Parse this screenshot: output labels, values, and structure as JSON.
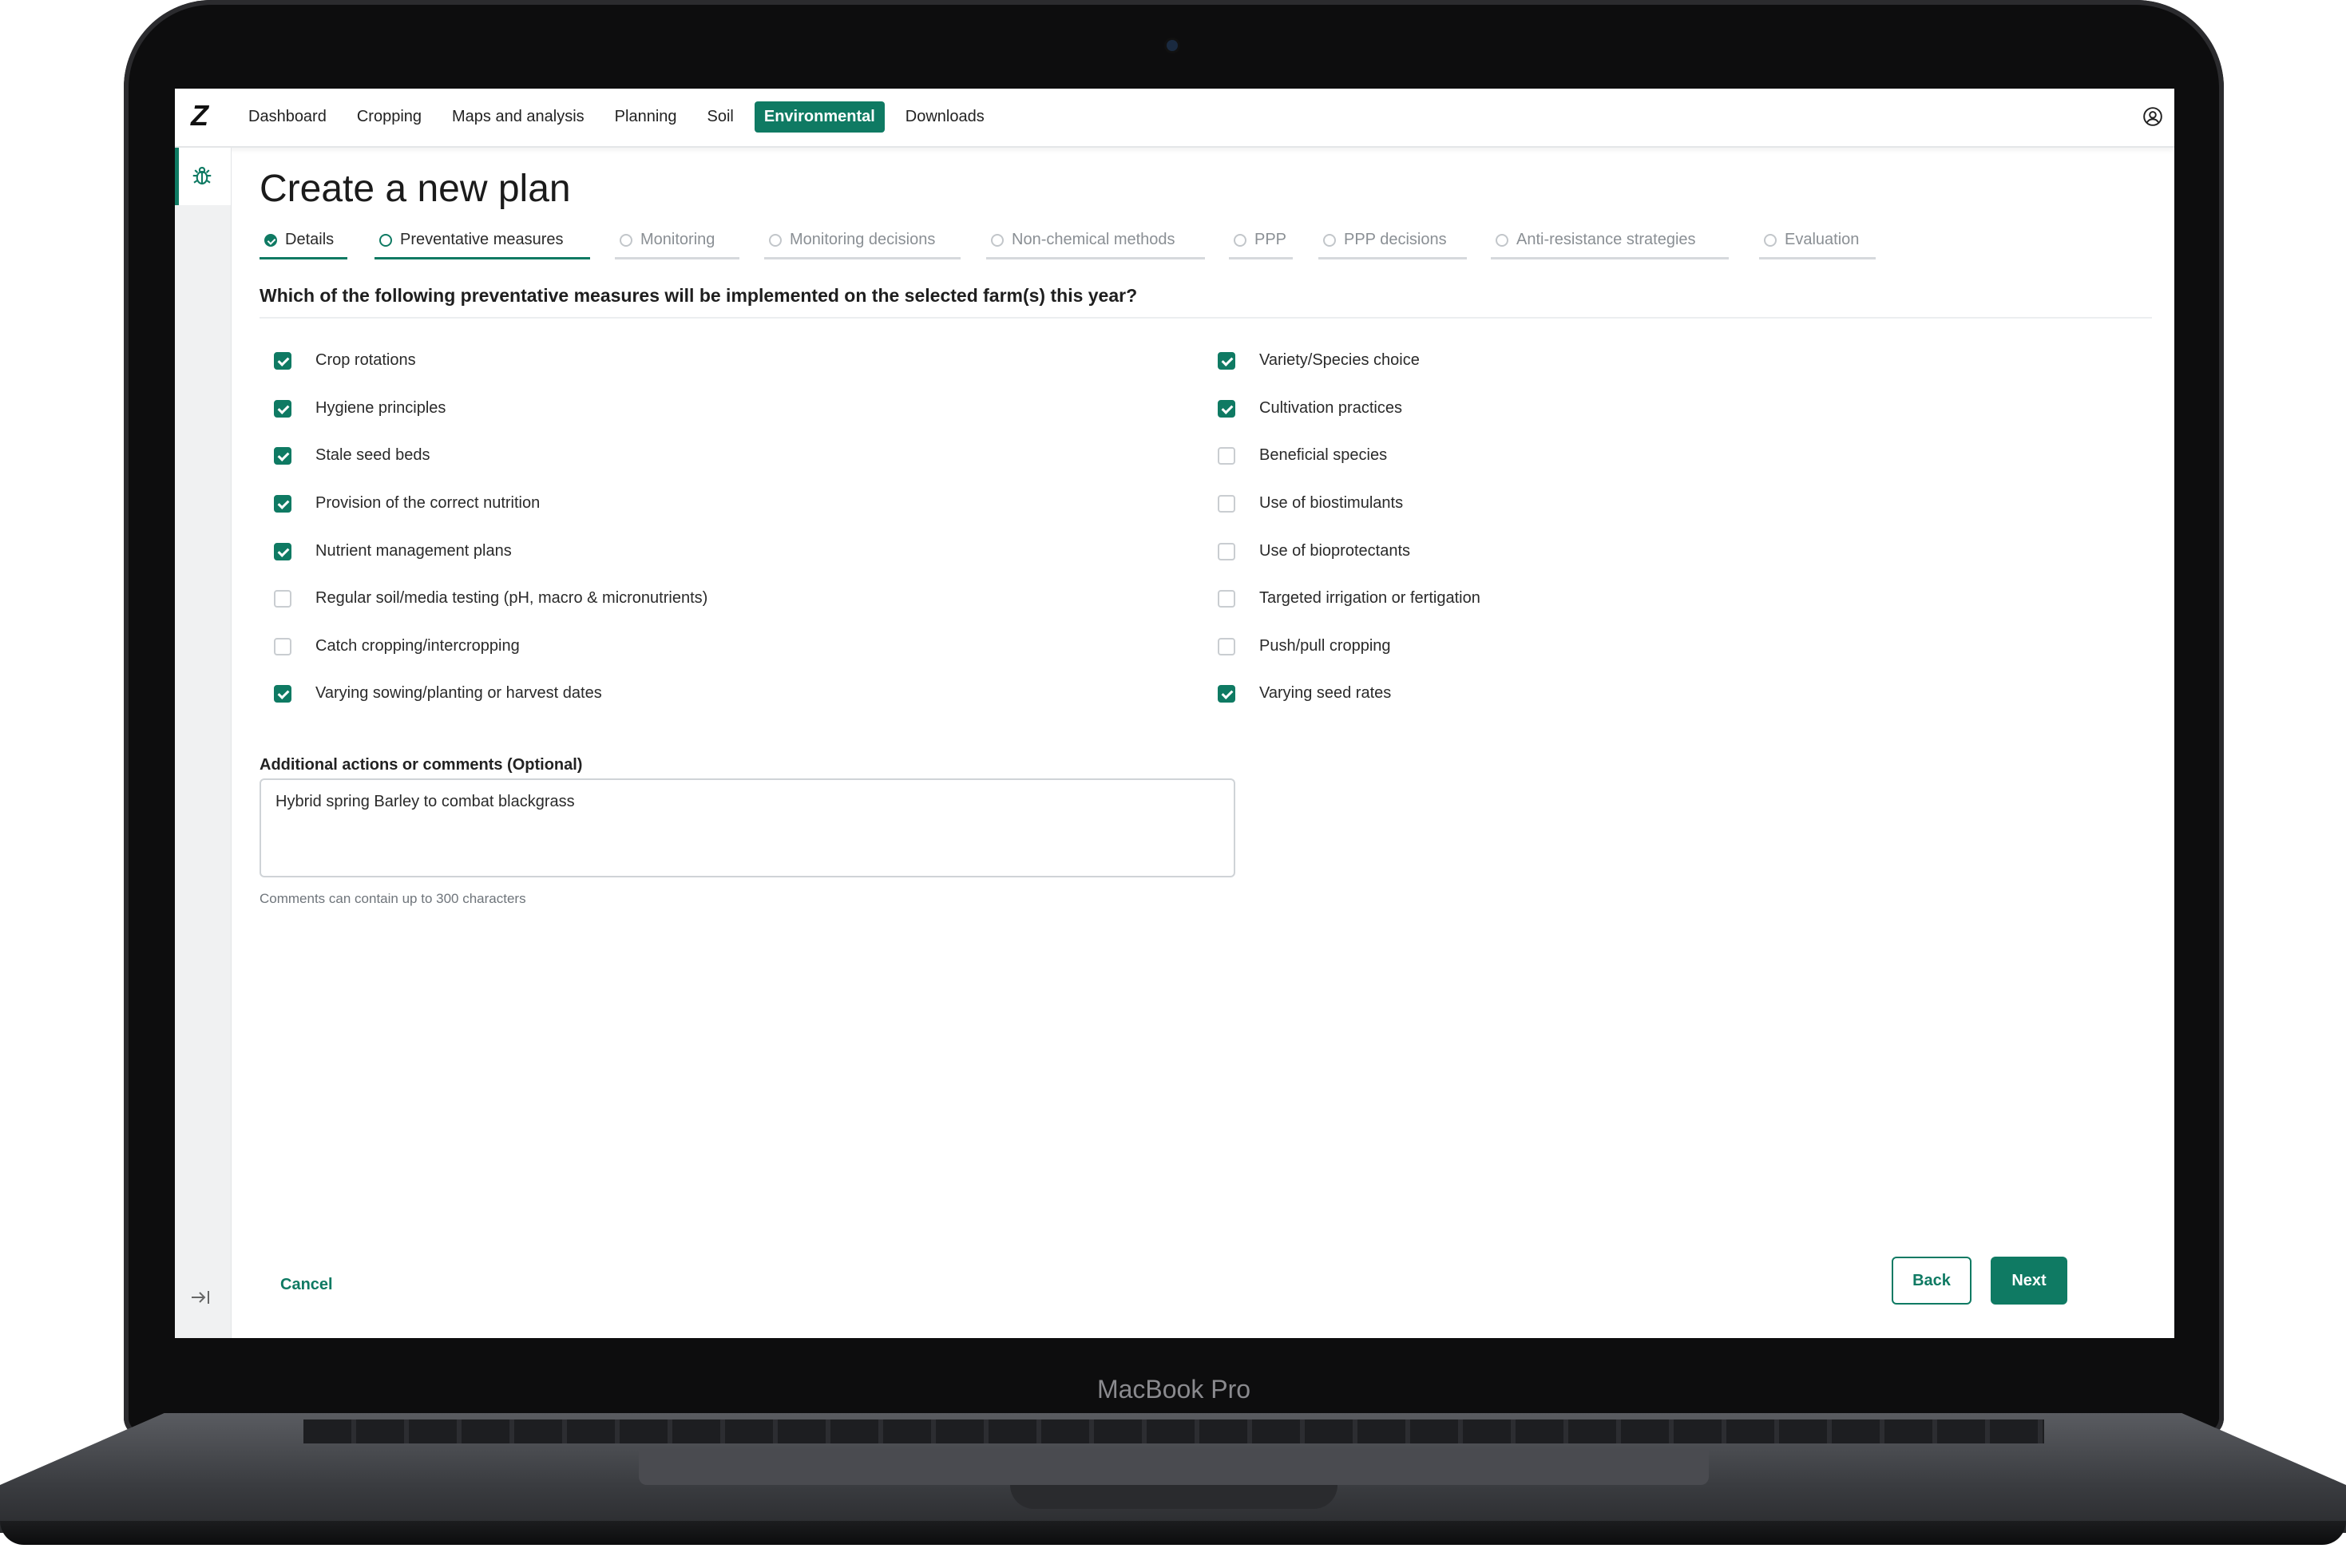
{
  "device": {
    "brand_label": "MacBook Pro"
  },
  "app": {
    "logo_text": "Z",
    "nav": [
      {
        "label": "Dashboard"
      },
      {
        "label": "Cropping"
      },
      {
        "label": "Maps and analysis"
      },
      {
        "label": "Planning"
      },
      {
        "label": "Soil"
      },
      {
        "label": "Environmental",
        "active": true
      },
      {
        "label": "Downloads"
      }
    ],
    "accent_color": "#0f7a63"
  },
  "page": {
    "title": "Create a new plan",
    "steps": [
      {
        "label": "Details",
        "state": "done"
      },
      {
        "label": "Preventative measures",
        "state": "current"
      },
      {
        "label": "Monitoring",
        "state": "todo"
      },
      {
        "label": "Monitoring decisions",
        "state": "todo"
      },
      {
        "label": "Non-chemical methods",
        "state": "todo"
      },
      {
        "label": "PPP",
        "state": "todo"
      },
      {
        "label": "PPP decisions",
        "state": "todo"
      },
      {
        "label": "Anti-resistance strategies",
        "state": "todo"
      },
      {
        "label": "Evaluation",
        "state": "todo"
      }
    ],
    "question": "Which of the following preventative measures will be implemented on the selected farm(s) this year?",
    "options_left": [
      {
        "label": "Crop rotations",
        "checked": true
      },
      {
        "label": "Hygiene principles",
        "checked": true
      },
      {
        "label": "Stale seed beds",
        "checked": true
      },
      {
        "label": "Provision of the correct nutrition",
        "checked": true
      },
      {
        "label": "Nutrient management plans",
        "checked": true
      },
      {
        "label": "Regular soil/media testing (pH, macro & micronutrients)",
        "checked": false
      },
      {
        "label": "Catch cropping/intercropping",
        "checked": false
      },
      {
        "label": "Varying sowing/planting or harvest dates",
        "checked": true
      }
    ],
    "options_right": [
      {
        "label": "Variety/Species choice",
        "checked": true
      },
      {
        "label": "Cultivation practices",
        "checked": true
      },
      {
        "label": "Beneficial species",
        "checked": false
      },
      {
        "label": "Use of biostimulants",
        "checked": false
      },
      {
        "label": "Use of bioprotectants",
        "checked": false
      },
      {
        "label": "Targeted irrigation or fertigation",
        "checked": false
      },
      {
        "label": "Push/pull cropping",
        "checked": false
      },
      {
        "label": "Varying seed rates",
        "checked": true
      }
    ],
    "comments": {
      "label": "Additional actions or comments (Optional)",
      "value": "Hybrid spring Barley to combat blackgrass",
      "help": "Comments can contain up to 300 characters"
    },
    "actions": {
      "cancel": "Cancel",
      "back": "Back",
      "next": "Next"
    }
  }
}
